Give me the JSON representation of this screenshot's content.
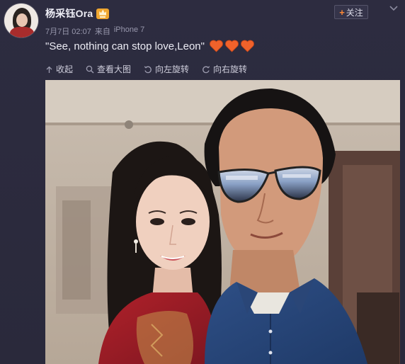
{
  "post": {
    "username": "杨采钰Ora",
    "date": "7月7日 02:07",
    "source_prefix": "来自",
    "source_device": "iPhone 7",
    "text": "\"See, nothing can stop love,Leon\"",
    "follow_label": "关注"
  },
  "toolbar": {
    "collapse_label": "收起",
    "view_large_label": "查看大图",
    "rotate_left_label": "向左旋转",
    "rotate_right_label": "向右旋转"
  },
  "icons": {
    "vip": "vip-crown-icon",
    "plus": "plus-icon",
    "more": "chevron-down-icon",
    "heart": "heart-icon",
    "collapse": "collapse-up-icon",
    "view_large": "magnifier-icon",
    "rotate_left": "rotate-left-icon",
    "rotate_right": "rotate-right-icon"
  },
  "colors": {
    "background": "#2b2a3d",
    "heart": "#f0622b",
    "vip": "#f0a730",
    "follow_plus": "#ff8a35"
  }
}
